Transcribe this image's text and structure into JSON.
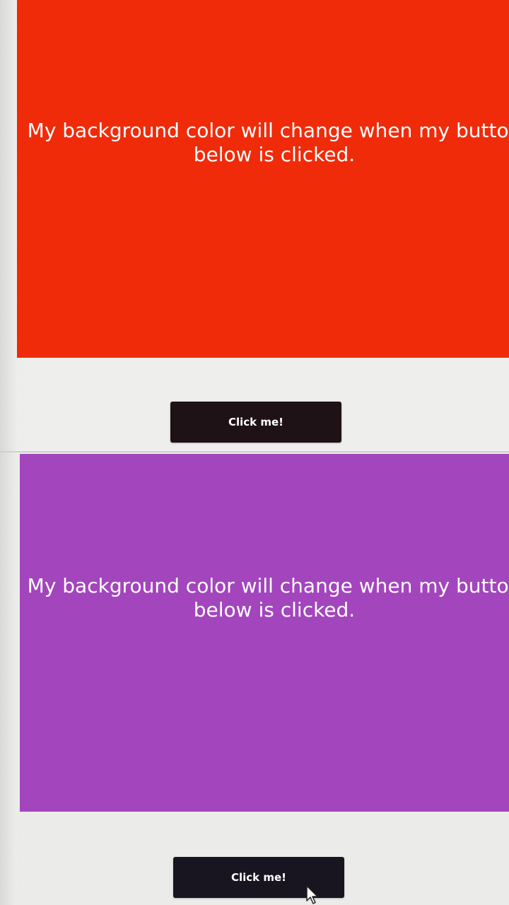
{
  "panels": [
    {
      "box_text": "My background color will change when my button below is clicked.",
      "box_color": "#f02b0a",
      "button_label": "Click me!"
    },
    {
      "box_text": "My background color will change when my button below is clicked.",
      "box_color": "#a345bd",
      "button_label": "Click me!"
    }
  ],
  "colors": {
    "page_bg": "#eeeeec",
    "button_bg": "#1e1216",
    "button_text": "#ffffff",
    "box_text": "#ffffff"
  },
  "icons": {
    "cursor": "mouse-pointer-icon"
  }
}
